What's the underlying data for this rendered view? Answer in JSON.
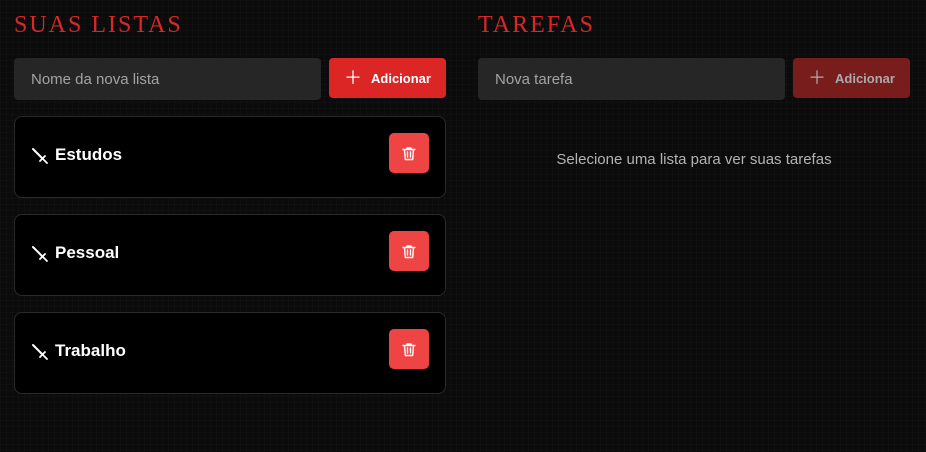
{
  "lists_panel": {
    "title": "SUAS LISTAS",
    "new_list_placeholder": "Nome da nova lista",
    "add_button_label": "Adicionar",
    "items": [
      {
        "label": "Estudos"
      },
      {
        "label": "Pessoal"
      },
      {
        "label": "Trabalho"
      }
    ]
  },
  "tasks_panel": {
    "title": "TAREFAS",
    "new_task_placeholder": "Nova tarefa",
    "add_button_label": "Adicionar",
    "empty_message": "Selecione uma lista para ver suas tarefas"
  },
  "colors": {
    "accent": "#dc2626",
    "delete": "#ef4444",
    "disabled_accent": "#7f1d1d"
  }
}
